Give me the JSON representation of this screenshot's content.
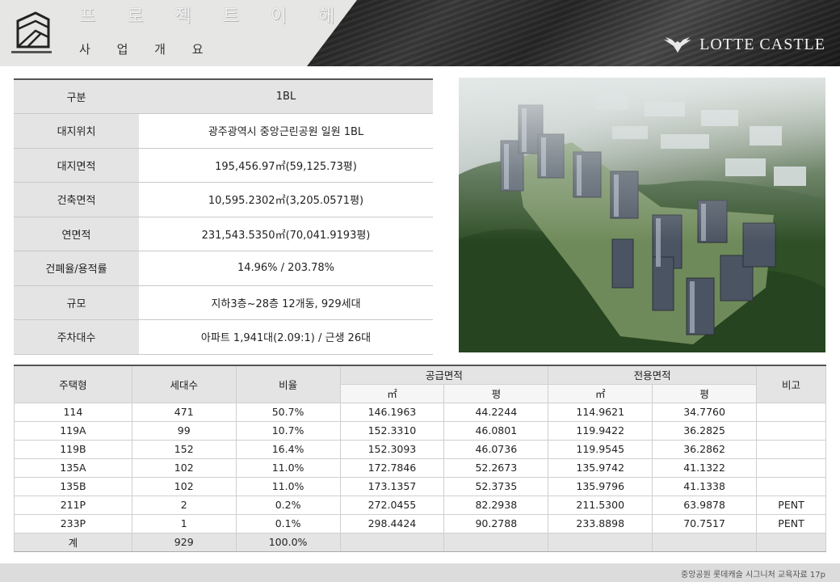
{
  "header": {
    "title": "프 로 젝 트 이 해",
    "subtitle": "사 업 개 요",
    "brand": "LOTTE CASTLE"
  },
  "info_table": [
    {
      "label": "구분",
      "value": "1BL"
    },
    {
      "label": "대지위치",
      "value": "광주광역시 중앙근린공원 일원 1BL"
    },
    {
      "label": "대지면적",
      "value": "195,456.97㎡(59,125.73평)"
    },
    {
      "label": "건축면적",
      "value": "10,595.2302㎡(3,205.0571평)"
    },
    {
      "label": "연면적",
      "value": "231,543.5350㎡(70,041.9193평)"
    },
    {
      "label": "건폐율/용적률",
      "value": "14.96% / 203.78%"
    },
    {
      "label": "규모",
      "value": "지하3층~28층 12개동, 929세대"
    },
    {
      "label": "주차대수",
      "value": "아파트 1,941대(2.09:1) / 근생 26대"
    }
  ],
  "unit_table": {
    "headers": {
      "type": "주택형",
      "count": "세대수",
      "ratio": "비율",
      "supply": "공급면적",
      "exclusive": "전용면적",
      "note": "비고",
      "sqm": "㎡",
      "pyeong": "평"
    },
    "rows": [
      [
        "114",
        "471",
        "50.7%",
        "146.1963",
        "44.2244",
        "114.9621",
        "34.7760",
        ""
      ],
      [
        "119A",
        "99",
        "10.7%",
        "152.3310",
        "46.0801",
        "119.9422",
        "36.2825",
        ""
      ],
      [
        "119B",
        "152",
        "16.4%",
        "152.3093",
        "46.0736",
        "119.9545",
        "36.2862",
        ""
      ],
      [
        "135A",
        "102",
        "11.0%",
        "172.7846",
        "52.2673",
        "135.9742",
        "41.1322",
        ""
      ],
      [
        "135B",
        "102",
        "11.0%",
        "173.1357",
        "52.3735",
        "135.9796",
        "41.1338",
        ""
      ],
      [
        "211P",
        "2",
        "0.2%",
        "272.0455",
        "82.2938",
        "211.5300",
        "63.9878",
        "PENT"
      ],
      [
        "233P",
        "1",
        "0.1%",
        "298.4424",
        "90.2788",
        "233.8898",
        "70.7517",
        "PENT"
      ],
      [
        "계",
        "929",
        "100.0%",
        "",
        "",
        "",
        "",
        ""
      ]
    ]
  },
  "footer": {
    "text": "중앙공원 롯데캐슬 시그니처 교육자료 17p"
  }
}
